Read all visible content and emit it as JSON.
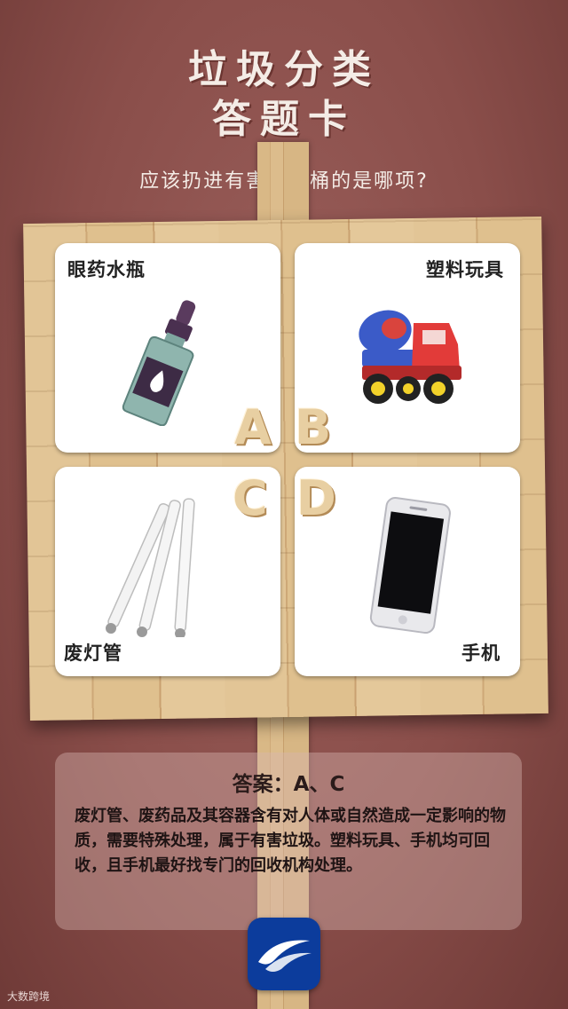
{
  "title": {
    "line1": "垃圾分类",
    "line2": "答题卡"
  },
  "question": "应该扔进有害垃圾桶的是哪项?",
  "options": [
    {
      "letter": "A",
      "label": "眼药水瓶",
      "icon": "eye-drop-bottle-icon"
    },
    {
      "letter": "B",
      "label": "塑料玩具",
      "icon": "toy-truck-icon"
    },
    {
      "letter": "C",
      "label": "废灯管",
      "icon": "fluorescent-tube-icon"
    },
    {
      "letter": "D",
      "label": "手机",
      "icon": "smartphone-icon"
    }
  ],
  "answer": {
    "title": "答案：A、C",
    "text": "废灯管、废药品及其容器含有对人体或自然造成一定影响的物质，需要特殊处理，属于有害垃圾。塑料玩具、手机均可回收，且手机最好找专门的回收机构处理。"
  },
  "app_icon": "wing-logo-icon",
  "watermark": "大数跨境",
  "colors": {
    "background": "#8a4e4a",
    "wood": "#dfc08e",
    "app_icon_bg": "#0c3c9c"
  }
}
